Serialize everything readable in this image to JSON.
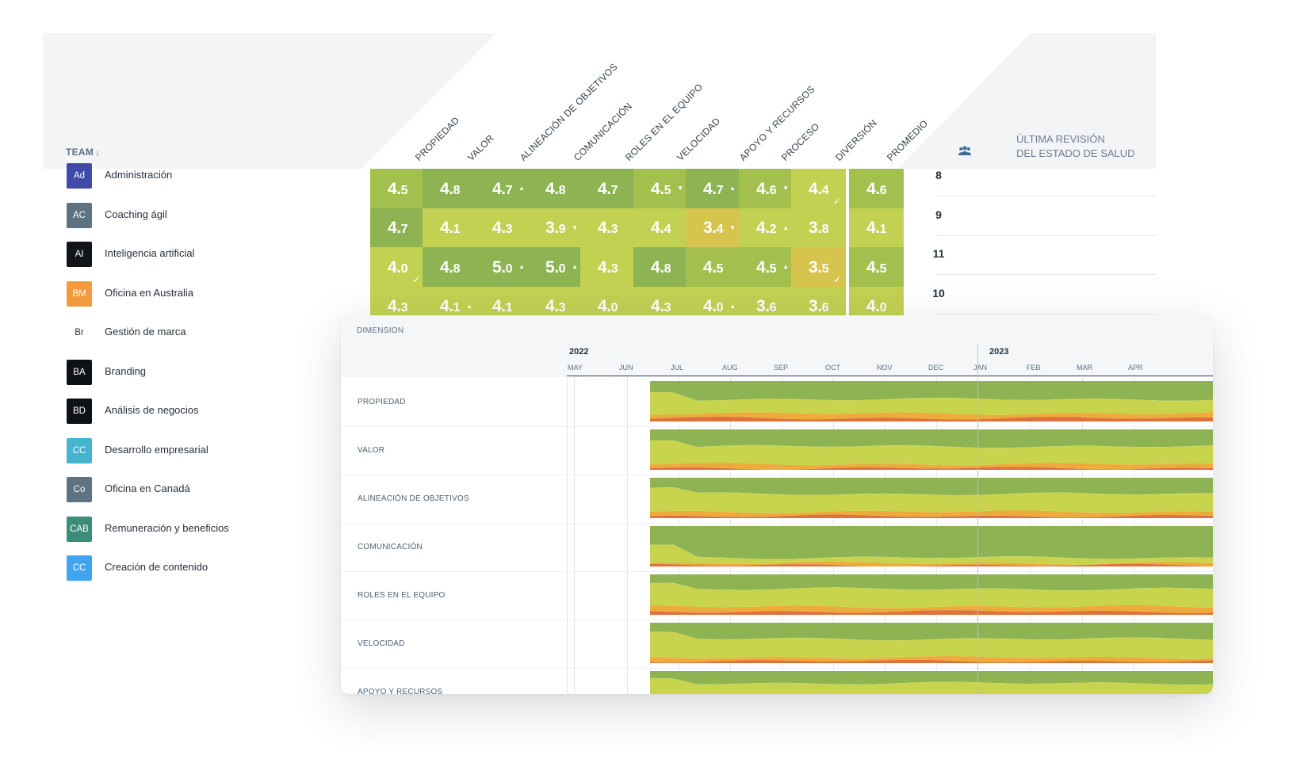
{
  "heatmap": {
    "team_header": "TEAM",
    "sort_icon": "arrow-down-icon",
    "columns": [
      "PROPIEDAD",
      "VALOR",
      "ALINEACIÓN DE OBJETIVOS",
      "COMUNICACIÓN",
      "ROLES EN EL EQUIPO",
      "VELOCIDAD",
      "APOYO Y RECURSOS",
      "PROCESO",
      "DIVERSIÓN",
      "PROMEDIO"
    ],
    "people_icon": "people-icon",
    "last_review_header": [
      "ÚLTIMA REVISIÓN",
      "DEL ESTADO DE SALUD"
    ],
    "colors": {
      "dark_green": "#8db352",
      "mid_green": "#a3c04f",
      "light_green": "#c2d152",
      "yellow": "#d7c44e",
      "header_bg": "#f2f4f6"
    },
    "teams": [
      {
        "abbr": "Ad",
        "name": "Administración",
        "avatar_color": "#3f4aa9",
        "count": "8",
        "scores": [
          [
            "4",
            "5",
            ""
          ],
          [
            "4",
            "8",
            ""
          ],
          [
            "4",
            "7",
            "up"
          ],
          [
            "4",
            "8",
            ""
          ],
          [
            "4",
            "7",
            ""
          ],
          [
            "4",
            "5",
            "down"
          ],
          [
            "4",
            "7",
            "up"
          ],
          [
            "4",
            "6",
            "down"
          ],
          [
            "4",
            "4",
            "check"
          ],
          [
            "4",
            "6",
            ""
          ]
        ]
      },
      {
        "abbr": "AC",
        "name": "Coaching ágil",
        "avatar_color": "#5d7381",
        "count": "9",
        "scores": [
          [
            "4",
            "7",
            ""
          ],
          [
            "4",
            "1",
            ""
          ],
          [
            "4",
            "3",
            ""
          ],
          [
            "3",
            "9",
            "down"
          ],
          [
            "4",
            "3",
            ""
          ],
          [
            "4",
            "4",
            ""
          ],
          [
            "3",
            "4",
            "down"
          ],
          [
            "4",
            "2",
            "up"
          ],
          [
            "3",
            "8",
            ""
          ],
          [
            "4",
            "1",
            ""
          ]
        ]
      },
      {
        "abbr": "AI",
        "name": "Inteligencia artificial",
        "avatar_color": "#111418",
        "count": "11",
        "scores": [
          [
            "4",
            "0",
            "check"
          ],
          [
            "4",
            "8",
            ""
          ],
          [
            "5",
            "0",
            "up"
          ],
          [
            "5",
            "0",
            "up"
          ],
          [
            "4",
            "3",
            ""
          ],
          [
            "4",
            "8",
            ""
          ],
          [
            "4",
            "5",
            ""
          ],
          [
            "4",
            "5",
            "up"
          ],
          [
            "3",
            "5",
            "check"
          ],
          [
            "4",
            "5",
            ""
          ]
        ]
      },
      {
        "abbr": "BM",
        "name": "Oficina en Australia",
        "avatar_color": "#f19a3e",
        "count": "10",
        "scores": [
          [
            "4",
            "3",
            ""
          ],
          [
            "4",
            "1",
            "up"
          ],
          [
            "4",
            "1",
            ""
          ],
          [
            "4",
            "3",
            ""
          ],
          [
            "4",
            "0",
            ""
          ],
          [
            "4",
            "3",
            ""
          ],
          [
            "4",
            "0",
            "up"
          ],
          [
            "3",
            "6",
            ""
          ],
          [
            "3",
            "6",
            ""
          ],
          [
            "4",
            "0",
            ""
          ]
        ]
      },
      {
        "abbr": "Br",
        "name": "Gestión de marca",
        "avatar_color": "#ffffff",
        "avatar_text": "#25303b",
        "count": "",
        "scores": []
      },
      {
        "abbr": "BA",
        "name": "Branding",
        "avatar_color": "#0f1215",
        "count": "",
        "scores": []
      },
      {
        "abbr": "BD",
        "name": "Análisis de negocios",
        "avatar_color": "#0f1215",
        "count": "",
        "scores": []
      },
      {
        "abbr": "CC",
        "name": "Desarrollo empresarial",
        "avatar_color": "#46b3cf",
        "count": "",
        "scores": []
      },
      {
        "abbr": "Co",
        "name": "Oficina en Canadá",
        "avatar_color": "#5d7381",
        "count": "",
        "scores": []
      },
      {
        "abbr": "CAB",
        "name": "Remuneración y beneficios",
        "avatar_color": "#3c8c7c",
        "count": "",
        "scores": []
      },
      {
        "abbr": "CC",
        "name": "Creación de contenido",
        "avatar_color": "#43a4ee",
        "count": "",
        "scores": []
      }
    ]
  },
  "timeline": {
    "dimension_header": "DIMENSION",
    "years": [
      "2022",
      "2023"
    ],
    "months": [
      "MAY",
      "JUN",
      "JUL",
      "AUG",
      "SEP",
      "OCT",
      "NOV",
      "DEC",
      "JAN",
      "FEB",
      "MAR",
      "APR"
    ],
    "dimensions": [
      "PROPIEDAD",
      "VALOR",
      "ALINEACIÓN DE OBJETIVOS",
      "COMUNICACIÓN",
      "ROLES EN EL EQUIPO",
      "VELOCIDAD",
      "APOYO Y RECURSOS"
    ],
    "stream_colors": {
      "dark": "#8db352",
      "light": "#c8d44e",
      "orange": "#ecab3a",
      "red": "#e0713a"
    }
  }
}
